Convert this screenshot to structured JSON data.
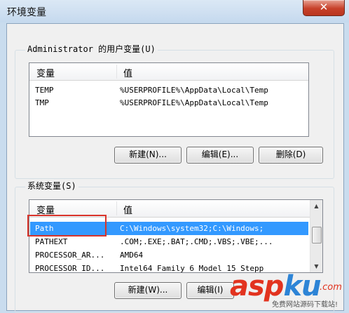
{
  "window": {
    "title": "环境变量",
    "close_glyph": "✕"
  },
  "user_vars": {
    "group_label": "Administrator 的用户变量(U)",
    "columns": [
      "变量",
      "值"
    ],
    "rows": [
      {
        "name": "TEMP",
        "value": "%USERPROFILE%\\AppData\\Local\\Temp"
      },
      {
        "name": "TMP",
        "value": "%USERPROFILE%\\AppData\\Local\\Temp"
      }
    ],
    "buttons": {
      "new": "新建(N)...",
      "edit": "编辑(E)...",
      "delete": "删除(D)"
    }
  },
  "system_vars": {
    "group_label": "系统变量(S)",
    "columns": [
      "变量",
      "值"
    ],
    "rows": [
      {
        "name": "Path",
        "value": "C:\\Windows\\system32;C:\\Windows;"
      },
      {
        "name": "PATHEXT",
        "value": ".COM;.EXE;.BAT;.CMD;.VBS;.VBE;..."
      },
      {
        "name": "PROCESSOR_AR...",
        "value": "AMD64"
      },
      {
        "name": "PROCESSOR_ID...",
        "value": "Intel64 Family 6 Model 15 Stepp"
      }
    ],
    "selected_row": 0,
    "buttons": {
      "new": "新建(W)...",
      "edit": "编辑(I)"
    }
  },
  "watermark": {
    "asp": "asp",
    "ku": "ku",
    "com": ".com",
    "sub": "免费网站源码下载站!"
  },
  "colors": {
    "highlight_border": "#d9342b",
    "selection": "#3399ff"
  }
}
